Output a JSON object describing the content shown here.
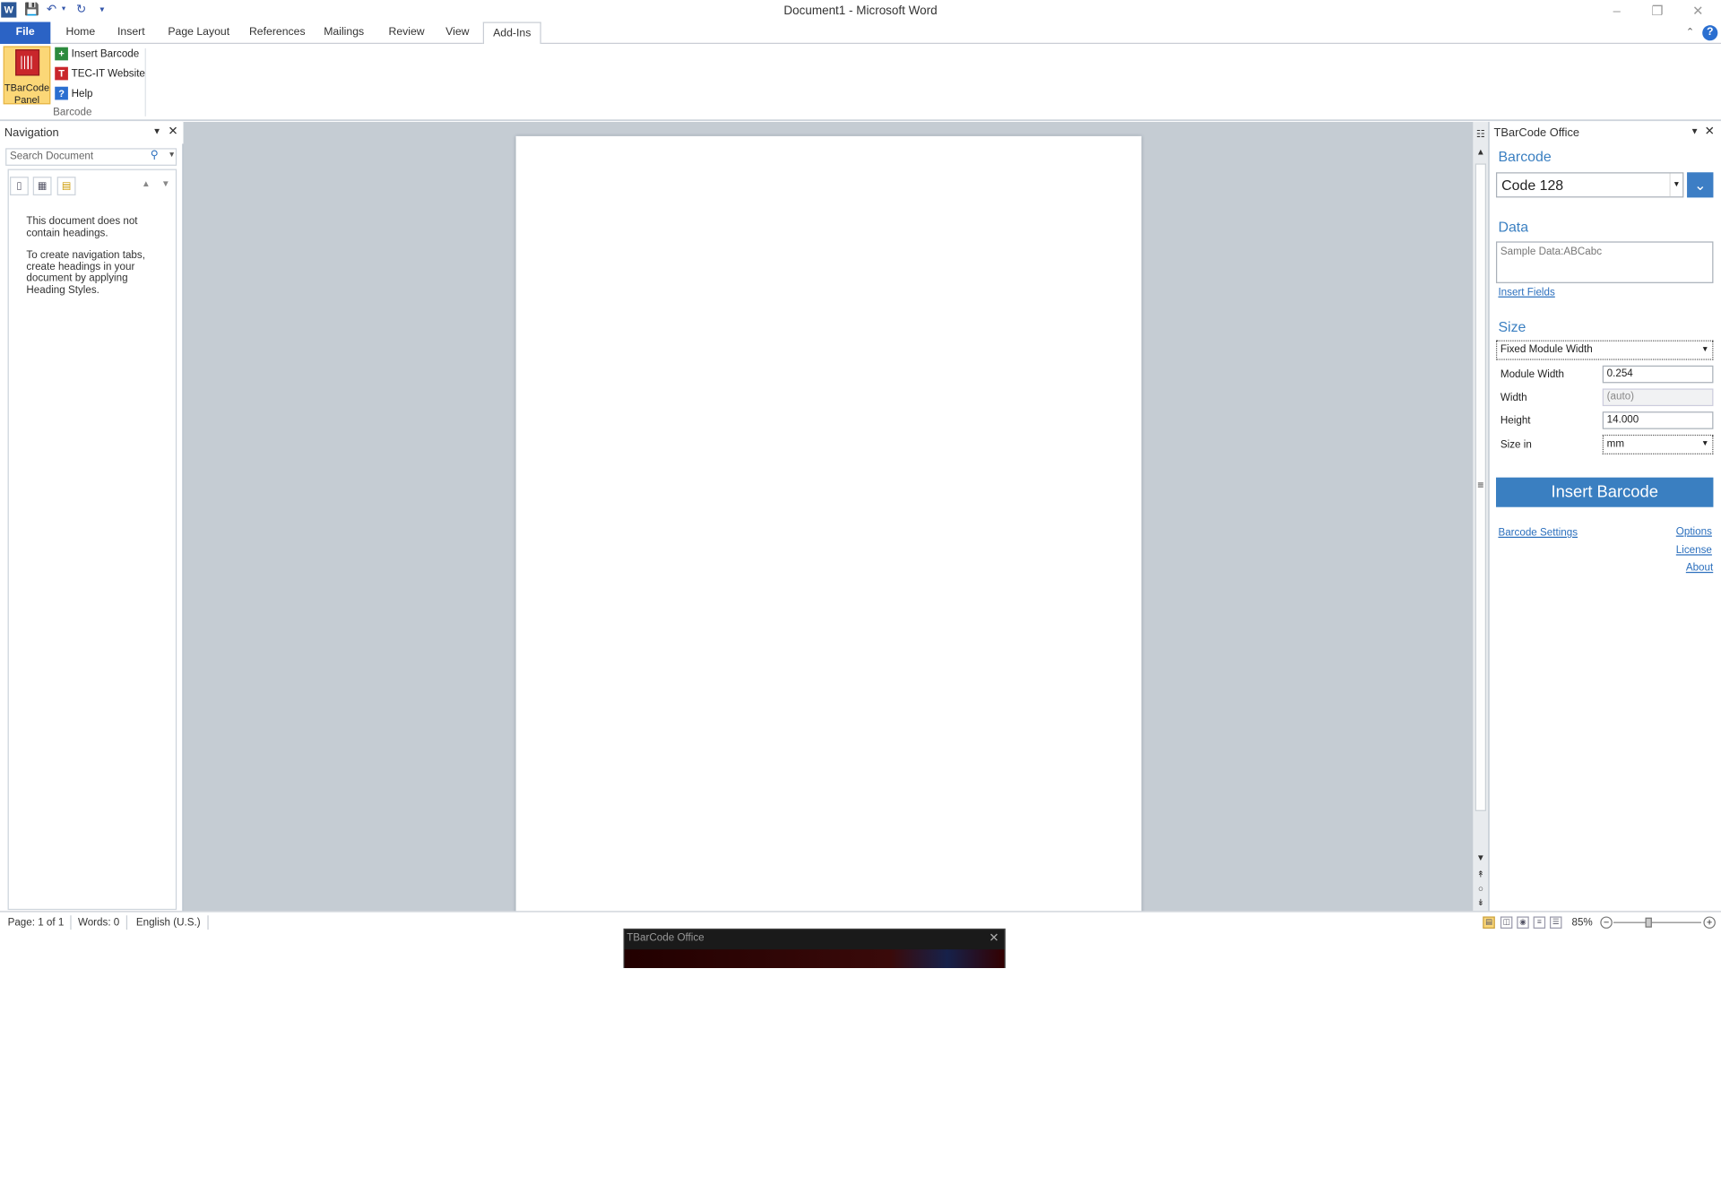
{
  "window": {
    "title": "Document1  -  Microsoft Word"
  },
  "ribbon": {
    "tabs": [
      "File",
      "Home",
      "Insert",
      "Page Layout",
      "References",
      "Mailings",
      "Review",
      "View",
      "Add-Ins"
    ],
    "active_tab": "Add-Ins",
    "tbarcode_panel_label_1": "TBarCode",
    "tbarcode_panel_label_2": "Panel",
    "items": [
      "Insert Barcode",
      "TEC-IT Website",
      "Help"
    ],
    "group_label": "Barcode"
  },
  "navigation": {
    "title": "Navigation",
    "search_placeholder": "Search Document",
    "message_1": "This document does not contain headings.",
    "message_2": "To create navigation tabs, create headings in your document by applying Heading Styles."
  },
  "panel": {
    "title": "TBarCode Office",
    "barcode_section": "Barcode",
    "barcode_type": "Code 128",
    "data_section": "Data",
    "data_value": "Sample Data:ABCabc",
    "insert_fields": "Insert Fields",
    "size_section": "Size",
    "size_mode": "Fixed Module Width",
    "fields": [
      {
        "label": "Module Width",
        "value": "0.254"
      },
      {
        "label": "Width",
        "value": "(auto)"
      },
      {
        "label": "Height",
        "value": "14.000"
      },
      {
        "label": "Size in",
        "value": "mm"
      }
    ],
    "insert_button": "Insert Barcode",
    "links": {
      "barcode_settings": "Barcode Settings",
      "options": "Options",
      "license": "License",
      "about": "About"
    }
  },
  "status": {
    "page": "Page: 1 of 1",
    "words": "Words: 0",
    "language": "English (U.S.)",
    "zoom": "85%",
    "zoom_level_fraction": 0.4
  },
  "popup": {
    "title": "TBarCode Office"
  },
  "colors": {
    "accent": "#3a7fc1",
    "file_tab": "#2b63c5",
    "ribbon_button_highlight": "#fbd777"
  }
}
